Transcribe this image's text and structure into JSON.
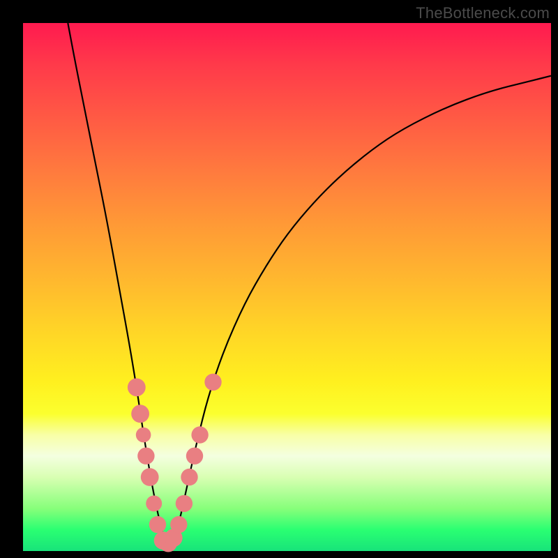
{
  "watermark": "TheBottleneck.com",
  "chart_data": {
    "type": "line",
    "title": "",
    "xlabel": "",
    "ylabel": "",
    "xlim": [
      0,
      100
    ],
    "ylim": [
      0,
      100
    ],
    "grid": false,
    "legend": false,
    "curve_description": "V-shaped bottleneck curve with minimum near x≈27; left branch is steeper than the right branch which asymptotically rises.",
    "curve": [
      {
        "x": 8.5,
        "y": 100
      },
      {
        "x": 10,
        "y": 92
      },
      {
        "x": 12,
        "y": 82
      },
      {
        "x": 14,
        "y": 72
      },
      {
        "x": 16,
        "y": 62
      },
      {
        "x": 18,
        "y": 51
      },
      {
        "x": 20,
        "y": 40
      },
      {
        "x": 21.5,
        "y": 31
      },
      {
        "x": 23,
        "y": 21
      },
      {
        "x": 24.5,
        "y": 12
      },
      {
        "x": 26,
        "y": 5
      },
      {
        "x": 27,
        "y": 1.5
      },
      {
        "x": 28,
        "y": 1.5
      },
      {
        "x": 29.5,
        "y": 5
      },
      {
        "x": 31,
        "y": 12
      },
      {
        "x": 33,
        "y": 21
      },
      {
        "x": 35,
        "y": 29
      },
      {
        "x": 38,
        "y": 38
      },
      {
        "x": 42,
        "y": 47
      },
      {
        "x": 46,
        "y": 54
      },
      {
        "x": 50,
        "y": 60
      },
      {
        "x": 55,
        "y": 66
      },
      {
        "x": 60,
        "y": 71
      },
      {
        "x": 66,
        "y": 76
      },
      {
        "x": 72,
        "y": 80
      },
      {
        "x": 80,
        "y": 84
      },
      {
        "x": 88,
        "y": 87
      },
      {
        "x": 96,
        "y": 89
      },
      {
        "x": 100,
        "y": 90
      }
    ],
    "markers": [
      {
        "x": 21.5,
        "y": 31,
        "r": 1.3
      },
      {
        "x": 22.2,
        "y": 26,
        "r": 1.3
      },
      {
        "x": 22.8,
        "y": 22,
        "r": 1.0
      },
      {
        "x": 23.3,
        "y": 18,
        "r": 1.2
      },
      {
        "x": 24.0,
        "y": 14,
        "r": 1.3
      },
      {
        "x": 24.8,
        "y": 9,
        "r": 1.1
      },
      {
        "x": 25.5,
        "y": 5,
        "r": 1.2
      },
      {
        "x": 26.5,
        "y": 2,
        "r": 1.3
      },
      {
        "x": 27.5,
        "y": 1.5,
        "r": 1.3
      },
      {
        "x": 28.5,
        "y": 2.5,
        "r": 1.3
      },
      {
        "x": 29.5,
        "y": 5,
        "r": 1.2
      },
      {
        "x": 30.5,
        "y": 9,
        "r": 1.2
      },
      {
        "x": 31.5,
        "y": 14,
        "r": 1.2
      },
      {
        "x": 32.5,
        "y": 18,
        "r": 1.2
      },
      {
        "x": 33.5,
        "y": 22,
        "r": 1.2
      },
      {
        "x": 36.0,
        "y": 32,
        "r": 1.2
      }
    ],
    "marker_color": "#e97f82",
    "curve_color": "#000000",
    "gradient_stops": [
      {
        "pos": 0,
        "color": "#ff1a4f"
      },
      {
        "pos": 50,
        "color": "#ffcf28"
      },
      {
        "pos": 74,
        "color": "#fbff2e"
      },
      {
        "pos": 100,
        "color": "#18e37a"
      }
    ]
  }
}
